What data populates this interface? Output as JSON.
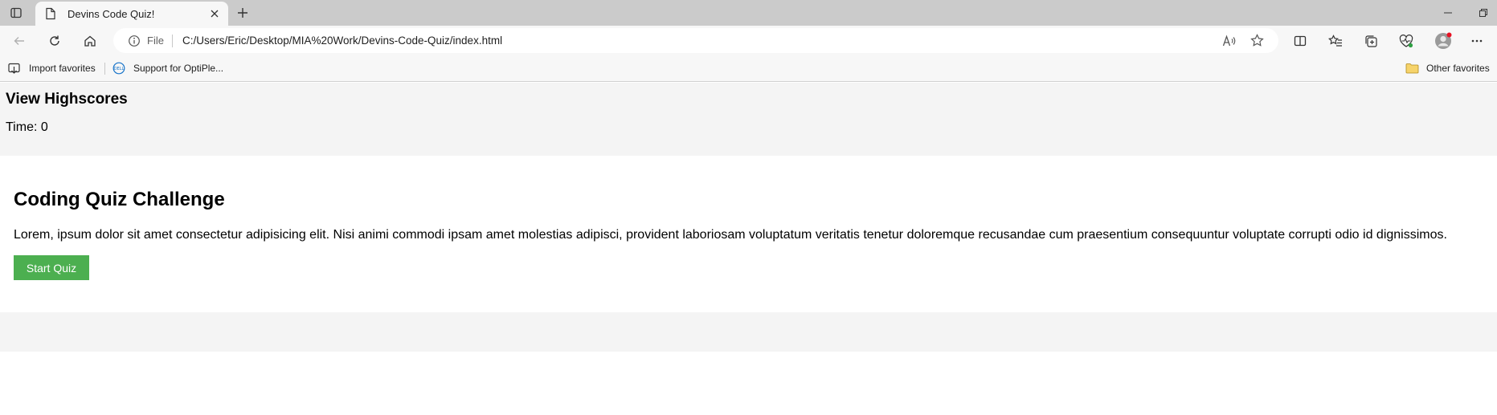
{
  "browser": {
    "tab": {
      "title": "Devins Code Quiz!"
    },
    "address_bar": {
      "scheme_label": "File",
      "url": "C:/Users/Eric/Desktop/MIA%20Work/Devins-Code-Quiz/index.html"
    },
    "bookmarks": [
      {
        "label": "Import favorites",
        "icon": "import-icon"
      },
      {
        "label": "Support for OptiPle...",
        "icon": "dell-icon"
      }
    ],
    "other_favorites": "Other favorites",
    "colors": {
      "tabstrip": "#cbcbcb",
      "toolbar": "#f7f7f7",
      "profile_badge": "#e81123"
    }
  },
  "page": {
    "header": {
      "highscores_link": "View Highscores",
      "timer_label": "Time: 0"
    },
    "quiz": {
      "title": "Coding Quiz Challenge",
      "intro": "Lorem, ipsum dolor sit amet consectetur adipisicing elit. Nisi animi commodi ipsam amet molestias adipisci, provident laboriosam voluptatum veritatis tenetur doloremque recusandae cum praesentium consequuntur voluptate corrupti odio id dignissimos.",
      "start_button": "Start Quiz"
    },
    "colors": {
      "band": "#f4f4f4",
      "start_button": "#4caf50"
    }
  }
}
